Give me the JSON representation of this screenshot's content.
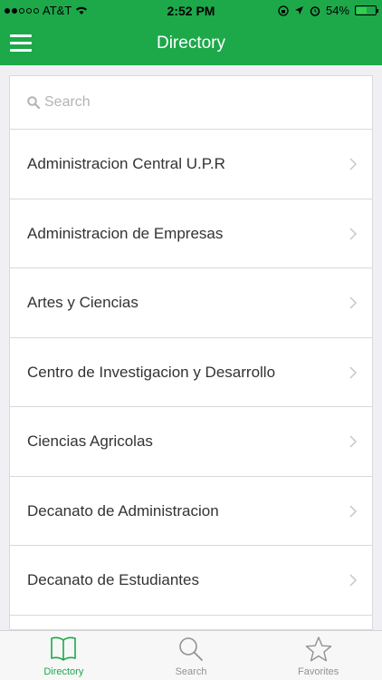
{
  "status_bar": {
    "carrier": "AT&T",
    "time": "2:52 PM",
    "battery": "54%",
    "battery_level": 0.54
  },
  "nav": {
    "title": "Directory",
    "menu_icon": "hamburger-menu-icon"
  },
  "search": {
    "placeholder": "Search",
    "value": ""
  },
  "directory": {
    "items": [
      {
        "label": "Administracion Central U.P.R"
      },
      {
        "label": "Administracion de Empresas"
      },
      {
        "label": "Artes y Ciencias"
      },
      {
        "label": "Centro de Investigacion y Desarrollo"
      },
      {
        "label": "Ciencias Agricolas"
      },
      {
        "label": "Decanato de Administracion"
      },
      {
        "label": "Decanato de Estudiantes"
      },
      {
        "label": ""
      }
    ]
  },
  "tabs": [
    {
      "label": "Directory",
      "icon": "book-icon",
      "active": true
    },
    {
      "label": "Search",
      "icon": "search-icon",
      "active": false
    },
    {
      "label": "Favorites",
      "icon": "star-icon",
      "active": false
    }
  ],
  "colors": {
    "accent": "#1da84a",
    "inactive": "#929292"
  }
}
